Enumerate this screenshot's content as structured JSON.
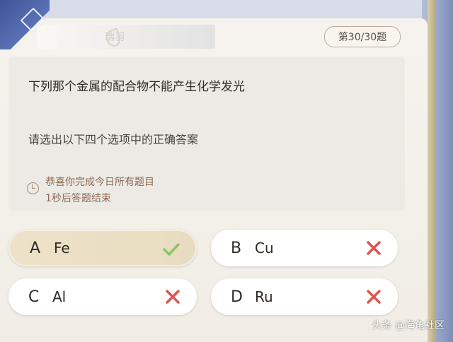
{
  "header": {
    "player_name": "瑞羽",
    "progress_label": "第30/30题"
  },
  "question": {
    "text": "下列那个金属的配合物不能产生化学发光",
    "instruction": "请选出以下四个选项中的正确答案",
    "notice_line1": "恭喜你完成今日所有题目",
    "notice_line2": "1秒后答题结束"
  },
  "options": [
    {
      "letter": "A",
      "text": "Fe",
      "result": "correct",
      "icon": "check-icon",
      "color": "#8fc26a"
    },
    {
      "letter": "B",
      "text": "Cu",
      "result": "wrong",
      "icon": "cross-icon",
      "color": "#e0524f"
    },
    {
      "letter": "C",
      "text": "Al",
      "result": "wrong",
      "icon": "cross-icon",
      "color": "#e0524f"
    },
    {
      "letter": "D",
      "text": "Ru",
      "result": "wrong",
      "icon": "cross-icon",
      "color": "#e0524f"
    }
  ],
  "watermark": "头条 @海龟社区"
}
